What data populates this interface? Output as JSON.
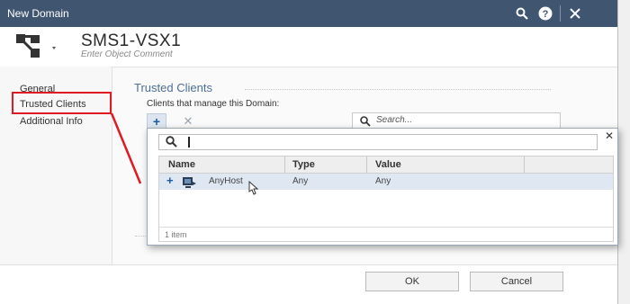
{
  "window": {
    "title": "New Domain",
    "object_name": "SMS1-VSX1",
    "comment_placeholder": "Enter Object Comment"
  },
  "sidebar": {
    "items": [
      {
        "label": "General",
        "selected": false
      },
      {
        "label": "Trusted Clients",
        "selected": true
      },
      {
        "label": "Additional Info",
        "selected": false
      }
    ]
  },
  "main": {
    "section_title": "Trusted Clients",
    "clients_label": "Clients that manage this Domain:",
    "add_icon": "plus-icon",
    "remove_icon": "x-icon",
    "search_placeholder": "Search..."
  },
  "popup": {
    "search_value": "",
    "columns": [
      "Name",
      "Type",
      "Value"
    ],
    "rows": [
      {
        "name": "AnyHost",
        "type": "Any",
        "value": "Any"
      }
    ],
    "item_count": "1 item"
  },
  "footer": {
    "ok_label": "OK",
    "cancel_label": "Cancel"
  },
  "colors": {
    "titlebar": "#405570",
    "accent": "#4d6e98",
    "highlight": "#e01a22",
    "selected_row": "#dfe8f2"
  }
}
